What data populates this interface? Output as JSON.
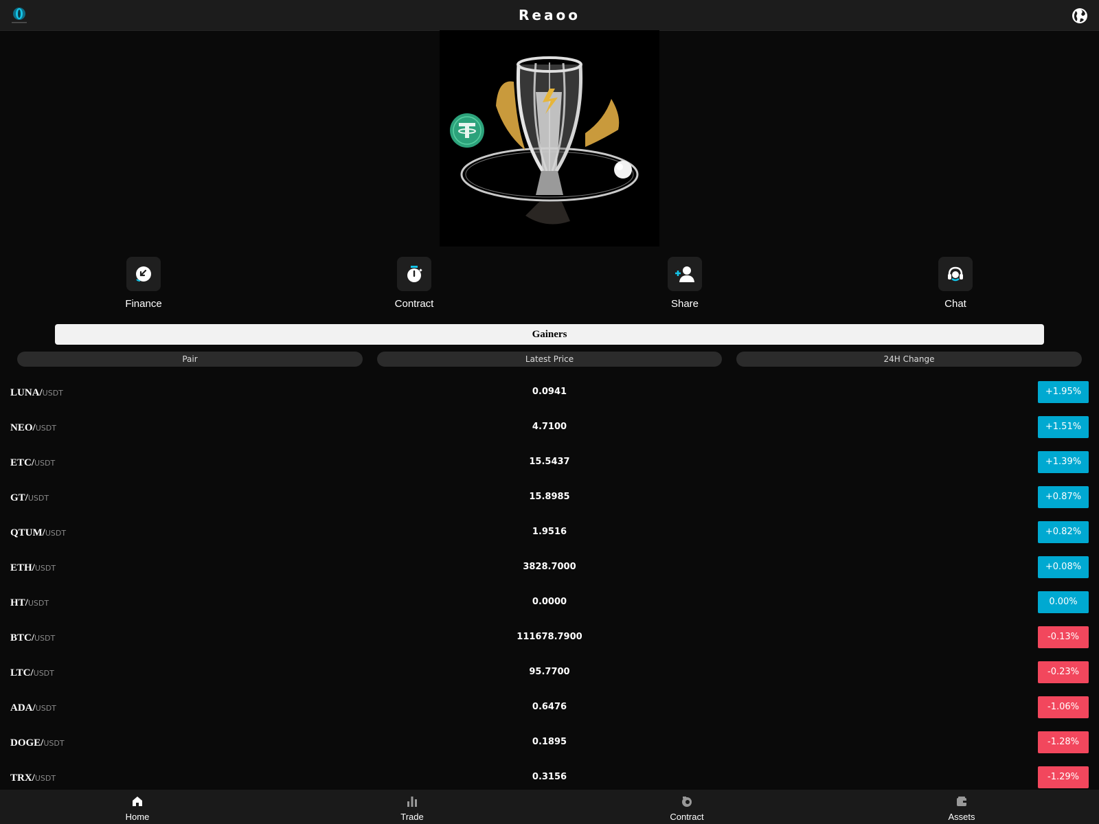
{
  "header": {
    "title": "Reaoo",
    "logo_icon": "app-logo-icon",
    "language_icon": "globe-icon"
  },
  "quick_actions": [
    {
      "label": "Finance",
      "icon": "finance-icon"
    },
    {
      "label": "Contract",
      "icon": "stopwatch-icon"
    },
    {
      "label": "Share",
      "icon": "add-user-icon"
    },
    {
      "label": "Chat",
      "icon": "headset-icon"
    }
  ],
  "market": {
    "tab": "Gainers",
    "columns": {
      "pair": "Pair",
      "price": "Latest Price",
      "change": "24H Change"
    },
    "rows": [
      {
        "base": "LUNA/",
        "quote": "USDT",
        "price": "0.0941",
        "change": "+1.95%",
        "direction": "up"
      },
      {
        "base": "NEO/",
        "quote": "USDT",
        "price": "4.7100",
        "change": "+1.51%",
        "direction": "up"
      },
      {
        "base": "ETC/",
        "quote": "USDT",
        "price": "15.5437",
        "change": "+1.39%",
        "direction": "up"
      },
      {
        "base": "GT/",
        "quote": "USDT",
        "price": "15.8985",
        "change": "+0.87%",
        "direction": "up"
      },
      {
        "base": "QTUM/",
        "quote": "USDT",
        "price": "1.9516",
        "change": "+0.82%",
        "direction": "up"
      },
      {
        "base": "ETH/",
        "quote": "USDT",
        "price": "3828.7000",
        "change": "+0.08%",
        "direction": "up"
      },
      {
        "base": "HT/",
        "quote": "USDT",
        "price": "0.0000",
        "change": "0.00%",
        "direction": "up"
      },
      {
        "base": "BTC/",
        "quote": "USDT",
        "price": "111678.7900",
        "change": "-0.13%",
        "direction": "down"
      },
      {
        "base": "LTC/",
        "quote": "USDT",
        "price": "95.7700",
        "change": "-0.23%",
        "direction": "down"
      },
      {
        "base": "ADA/",
        "quote": "USDT",
        "price": "0.6476",
        "change": "-1.06%",
        "direction": "down"
      },
      {
        "base": "DOGE/",
        "quote": "USDT",
        "price": "0.1895",
        "change": "-1.28%",
        "direction": "down"
      },
      {
        "base": "TRX/",
        "quote": "USDT",
        "price": "0.3156",
        "change": "-1.29%",
        "direction": "down"
      }
    ]
  },
  "bottom_nav": [
    {
      "label": "Home",
      "icon": "home-icon"
    },
    {
      "label": "Trade",
      "icon": "bar-chart-icon"
    },
    {
      "label": "Contract",
      "icon": "contract-icon"
    },
    {
      "label": "Assets",
      "icon": "wallet-icon"
    }
  ],
  "colors": {
    "up": "#00a9d1",
    "down": "#f2475d",
    "accent": "#14c4e8"
  }
}
